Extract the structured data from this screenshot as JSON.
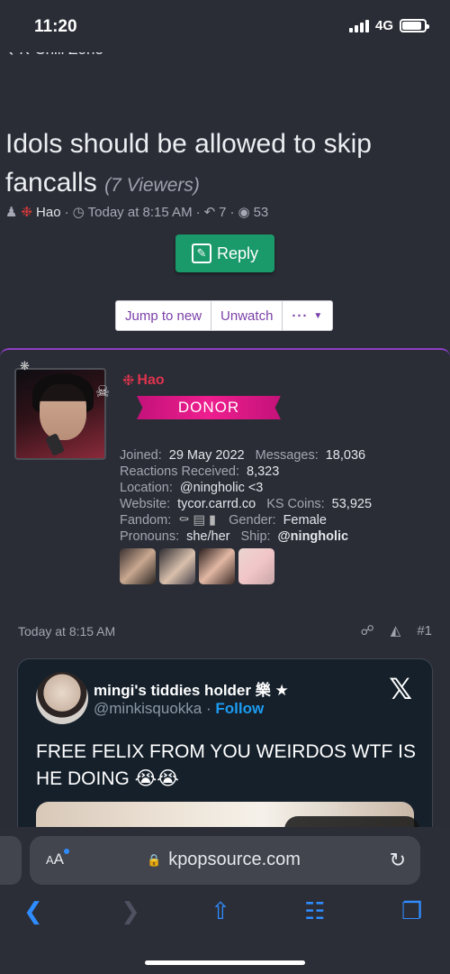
{
  "status_bar": {
    "time": "11:20",
    "network": "4G"
  },
  "breadcrumb": {
    "label": "K-Chill Zone"
  },
  "thread": {
    "title": "Idols should be allowed to skip fancalls",
    "viewers": "(7 Viewers)",
    "author": "Hao",
    "timestamp": "Today at 8:15 AM",
    "replies": "7",
    "views": "53"
  },
  "actions": {
    "reply_label": "Reply",
    "jump_label": "Jump to new",
    "unwatch_label": "Unwatch",
    "more_label": "···"
  },
  "post": {
    "username": "Hao",
    "banner": "DONOR",
    "stats": {
      "joined_label": "Joined:",
      "joined": "29 May 2022",
      "messages_label": "Messages:",
      "messages": "18,036",
      "reactions_label": "Reactions Received:",
      "reactions": "8,323",
      "location_label": "Location:",
      "location": "@ningholic <3",
      "website_label": "Website:",
      "website": "tycor.carrd.co",
      "coins_label": "KS Coins:",
      "coins": "53,925",
      "fandom_label": "Fandom:",
      "gender_label": "Gender:",
      "gender": "Female",
      "pronouns_label": "Pronouns:",
      "pronouns": "she/her",
      "ship_label": "Ship:",
      "ship": "@ningholic"
    },
    "time": "Today at 8:15 AM",
    "number": "#1"
  },
  "tweet": {
    "display_name": "mingi's tiddies holder 樂 ★",
    "handle": "@minkisquokka",
    "separator": " · ",
    "follow": "Follow",
    "x_logo": "𝕏",
    "text": "FREE FELIX FROM YOU WEIRDOS WTF IS HE DOING 😭😭"
  },
  "browser": {
    "aa": "A",
    "aa_big": "A",
    "domain": "kpopsource.com"
  },
  "colors": {
    "background": "#2a2d36",
    "reply_green": "#1a9a6b",
    "post_accent": "#8e3fc2",
    "donor_pink": "#ee1e8e",
    "username_red": "#e0334e",
    "link_blue": "#1d9bf0",
    "safari_blue": "#2f8cff"
  }
}
